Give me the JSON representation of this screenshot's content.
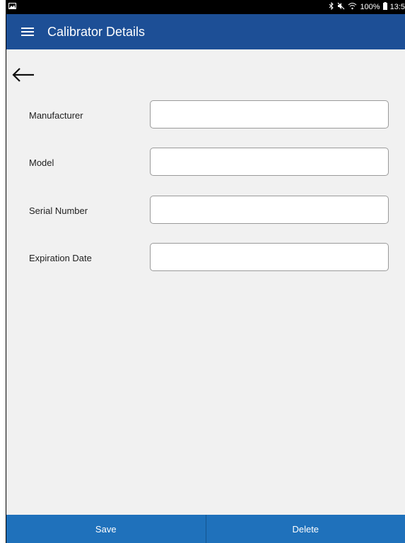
{
  "status_bar": {
    "left_icon": "image-icon",
    "icons": [
      "bluetooth-icon",
      "mute-icon",
      "wifi-icon"
    ],
    "battery_text": "100%",
    "battery_icon": "battery-icon",
    "time": "13:5"
  },
  "app_bar": {
    "title": "Calibrator Details",
    "menu_icon": "hamburger-menu-icon"
  },
  "navigation": {
    "back_icon": "back-arrow-icon"
  },
  "form": {
    "fields": [
      {
        "label": "Manufacturer",
        "value": "",
        "placeholder": ""
      },
      {
        "label": "Model",
        "value": "",
        "placeholder": ""
      },
      {
        "label": "Serial Number",
        "value": "",
        "placeholder": ""
      },
      {
        "label": "Expiration Date",
        "value": "",
        "placeholder": ""
      }
    ]
  },
  "actions": {
    "save_label": "Save",
    "delete_label": "Delete"
  },
  "colors": {
    "app_bar": "#1d4f96",
    "bottom_bar": "#1f71bb",
    "background": "#f1f1f1"
  }
}
